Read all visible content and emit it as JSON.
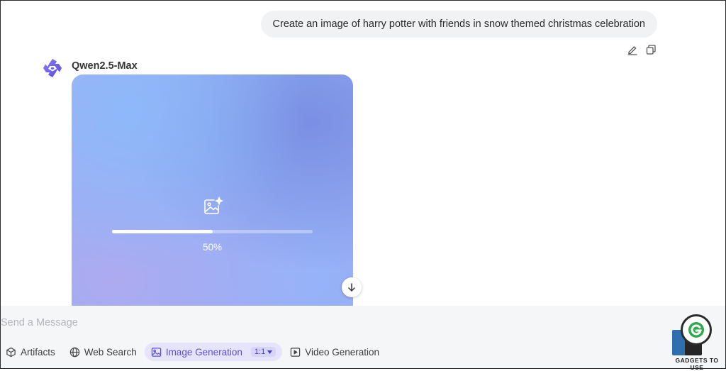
{
  "conversation": {
    "user_message": "Create an image of harry potter with friends in snow themed christmas celebration",
    "model_name": "Qwen2.5-Max"
  },
  "generation": {
    "progress_percent": 50,
    "progress_label": "50%"
  },
  "composer": {
    "placeholder": "Send a Message",
    "tools": {
      "artifacts": "Artifacts",
      "web_search": "Web Search",
      "image_generation": "Image Generation",
      "aspect_ratio": "1:1",
      "video_generation": "Video Generation"
    }
  },
  "watermark": {
    "text": "GADGETS TO USE"
  },
  "colors": {
    "accent": "#5a4fd8",
    "active_tool_bg": "#e6e4fb",
    "bubble_bg": "#f1f2f4"
  },
  "icons": {
    "edit": "pencil-icon",
    "copy": "copy-icon",
    "model_logo": "qwen-logo-icon",
    "image_gen": "image-sparkle-icon",
    "scroll_down": "arrow-down-icon",
    "artifacts": "cube-icon",
    "web_search": "globe-icon",
    "image_generation": "image-icon",
    "video_generation": "play-square-icon"
  }
}
